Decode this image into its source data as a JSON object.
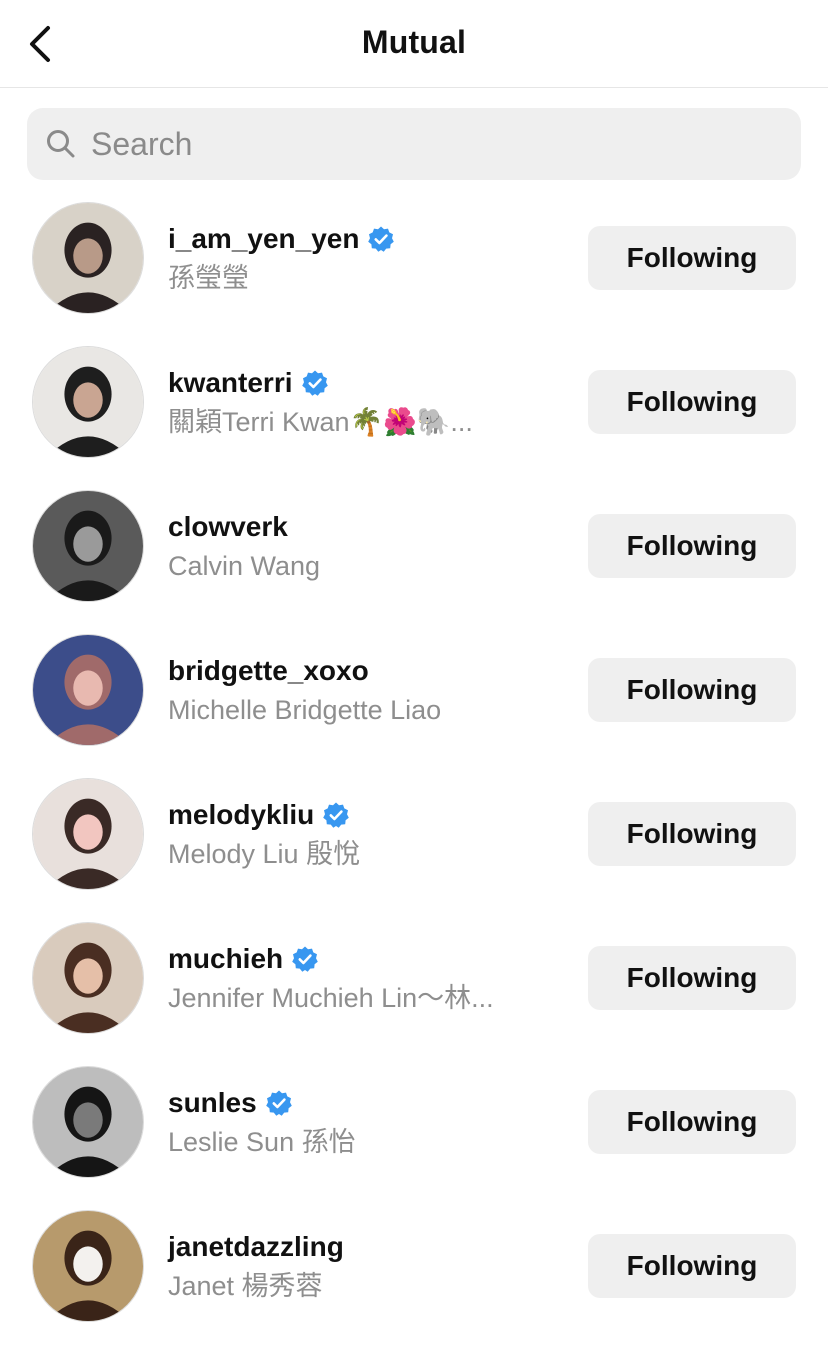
{
  "header": {
    "title": "Mutual",
    "back_icon": "chevron-left-icon"
  },
  "search": {
    "placeholder": "Search",
    "value": "",
    "icon": "search-icon"
  },
  "accent": {
    "verified": "#3897f0"
  },
  "users": [
    {
      "username": "i_am_yen_yen",
      "full_name": "孫瑩瑩",
      "verified": true,
      "button": "Following",
      "avatar_colors": [
        "#d8d2c8",
        "#2a2222",
        "#b89a88"
      ]
    },
    {
      "username": "kwanterri",
      "full_name": "關穎Terri Kwan🌴🌺🐘...",
      "verified": true,
      "button": "Following",
      "avatar_colors": [
        "#e9e7e4",
        "#1e1e1e",
        "#c9a592"
      ]
    },
    {
      "username": "clowverk",
      "full_name": "Calvin Wang",
      "verified": false,
      "button": "Following",
      "avatar_colors": [
        "#5a5a5a",
        "#1a1a1a",
        "#9a9a9a"
      ]
    },
    {
      "username": "bridgette_xoxo",
      "full_name": "Michelle Bridgette Liao",
      "verified": false,
      "button": "Following",
      "avatar_colors": [
        "#3c4d8a",
        "#a06a6a",
        "#e8b9b0"
      ]
    },
    {
      "username": "melodykliu",
      "full_name": "Melody Liu 殷悅",
      "verified": true,
      "button": "Following",
      "avatar_colors": [
        "#e8e0dc",
        "#3a2a26",
        "#f2c6c0"
      ]
    },
    {
      "username": "muchieh",
      "full_name": "Jennifer Muchieh Lin～林...",
      "verified": true,
      "button": "Following",
      "avatar_colors": [
        "#d9cbbd",
        "#4a2e22",
        "#e5bfa8"
      ]
    },
    {
      "username": "sunles",
      "full_name": "Leslie Sun 孫怡",
      "verified": true,
      "button": "Following",
      "avatar_colors": [
        "#bdbdbd",
        "#151515",
        "#7a7a7a"
      ]
    },
    {
      "username": "janetdazzling",
      "full_name": "Janet 楊秀蓉",
      "verified": false,
      "button": "Following",
      "avatar_colors": [
        "#b79a6c",
        "#3a2418",
        "#f3f1ee"
      ]
    }
  ]
}
